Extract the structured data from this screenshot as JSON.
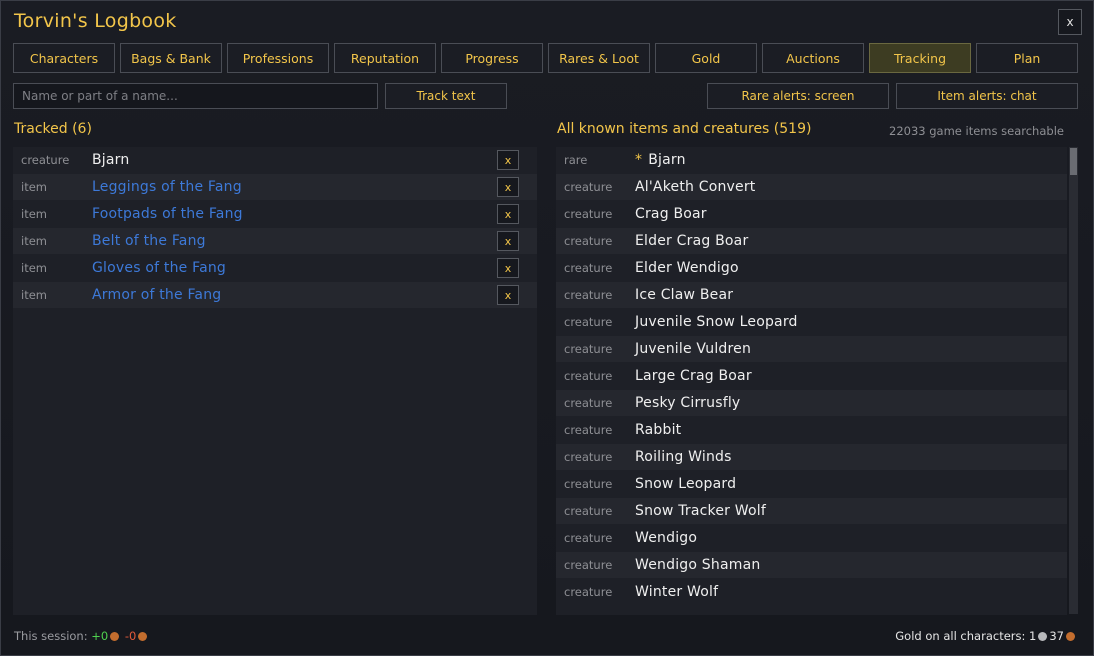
{
  "window": {
    "title": "Torvin's Logbook",
    "close_label": "x"
  },
  "tabs": [
    {
      "label": "Characters"
    },
    {
      "label": "Bags & Bank"
    },
    {
      "label": "Professions"
    },
    {
      "label": "Reputation"
    },
    {
      "label": "Progress"
    },
    {
      "label": "Rares & Loot"
    },
    {
      "label": "Gold"
    },
    {
      "label": "Auctions"
    },
    {
      "label": "Tracking",
      "active": true
    },
    {
      "label": "Plan"
    }
  ],
  "search": {
    "placeholder": "Name or part of a name...",
    "value": ""
  },
  "buttons": {
    "track_text": "Track text",
    "rare_alerts": "Rare alerts: screen",
    "item_alerts": "Item alerts: chat"
  },
  "tracked": {
    "title": "Tracked (6)",
    "remove_label": "x",
    "rows": [
      {
        "kind": "creature",
        "name": "Bjarn",
        "link": false
      },
      {
        "kind": "item",
        "name": "Leggings of the Fang",
        "link": true
      },
      {
        "kind": "item",
        "name": "Footpads of the Fang",
        "link": true
      },
      {
        "kind": "item",
        "name": "Belt of the Fang",
        "link": true
      },
      {
        "kind": "item",
        "name": "Gloves of the Fang",
        "link": true
      },
      {
        "kind": "item",
        "name": "Armor of the Fang",
        "link": true
      }
    ]
  },
  "known": {
    "title": "All known items and creatures (519)",
    "searchable_note": "22033 game items searchable",
    "rows": [
      {
        "kind": "rare",
        "star": "*",
        "name": "Bjarn"
      },
      {
        "kind": "creature",
        "name": "Al'Aketh Convert"
      },
      {
        "kind": "creature",
        "name": "Crag Boar"
      },
      {
        "kind": "creature",
        "name": "Elder Crag Boar"
      },
      {
        "kind": "creature",
        "name": "Elder Wendigo"
      },
      {
        "kind": "creature",
        "name": "Ice Claw Bear"
      },
      {
        "kind": "creature",
        "name": "Juvenile Snow Leopard"
      },
      {
        "kind": "creature",
        "name": "Juvenile Vuldren"
      },
      {
        "kind": "creature",
        "name": "Large Crag Boar"
      },
      {
        "kind": "creature",
        "name": "Pesky Cirrusfly"
      },
      {
        "kind": "creature",
        "name": "Rabbit"
      },
      {
        "kind": "creature",
        "name": "Roiling Winds"
      },
      {
        "kind": "creature",
        "name": "Snow Leopard"
      },
      {
        "kind": "creature",
        "name": "Snow Tracker Wolf"
      },
      {
        "kind": "creature",
        "name": "Wendigo"
      },
      {
        "kind": "creature",
        "name": "Wendigo Shaman"
      },
      {
        "kind": "creature",
        "name": "Winter Wolf"
      }
    ]
  },
  "footer": {
    "session_label": "This session:",
    "gain": "+0",
    "loss": "-0",
    "gold_label": "Gold on all characters:",
    "silver": "1",
    "copper": "37"
  },
  "colors": {
    "accent": "#f2c54a",
    "item_link": "#3d79d8",
    "gain": "#4fd14f",
    "loss": "#e35a3a"
  }
}
